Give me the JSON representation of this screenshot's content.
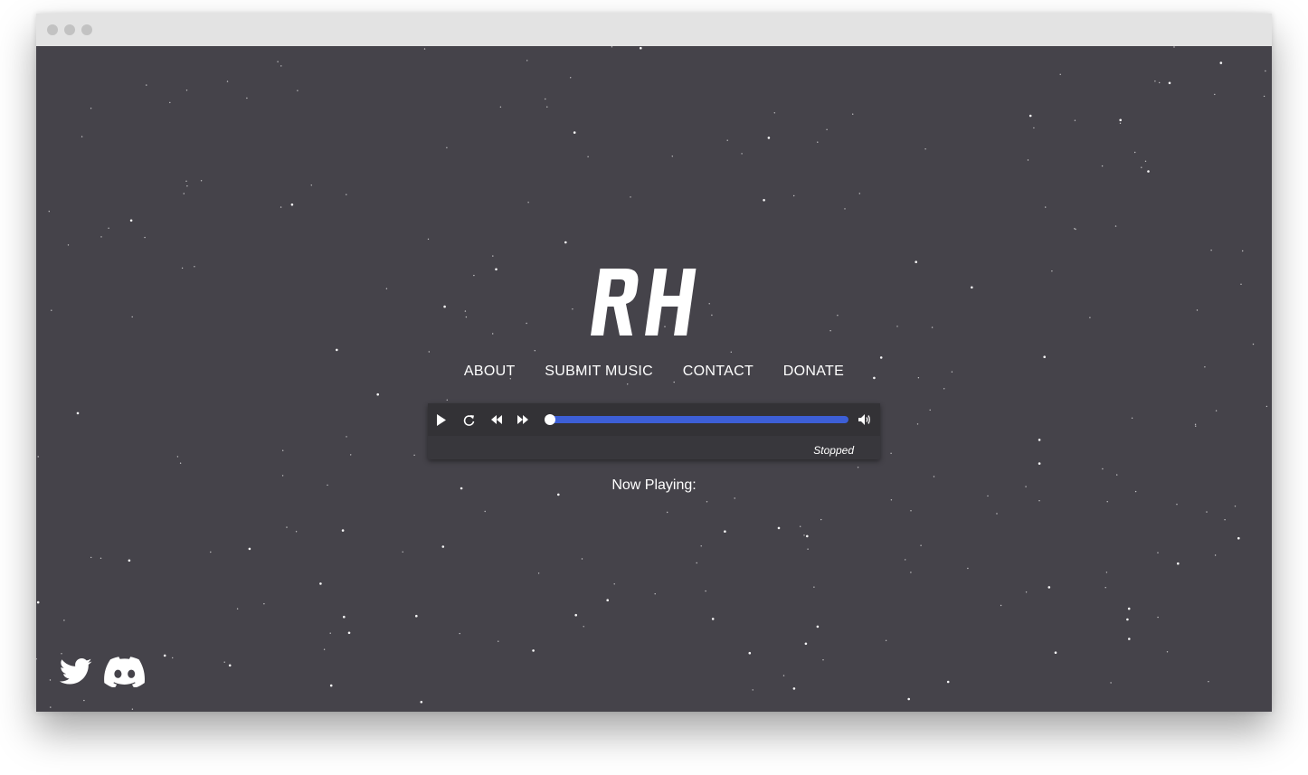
{
  "brand": {
    "logo_text": "RH",
    "icon": "rh-logo"
  },
  "nav": {
    "items": [
      {
        "label": "ABOUT"
      },
      {
        "label": "SUBMIT MUSIC"
      },
      {
        "label": "CONTACT"
      },
      {
        "label": "DONATE"
      }
    ]
  },
  "player": {
    "buttons": [
      {
        "icon": "play-icon"
      },
      {
        "icon": "reload-icon"
      },
      {
        "icon": "rewind-icon"
      },
      {
        "icon": "fast-forward-icon"
      },
      {
        "icon": "volume-icon"
      }
    ],
    "progress_fraction": 1.0,
    "status": "Stopped",
    "accent_color": "#3d5fd6"
  },
  "now_playing": {
    "label": "Now Playing:"
  },
  "social": [
    {
      "icon": "twitter-icon"
    },
    {
      "icon": "discord-icon"
    }
  ],
  "colors": {
    "background": "#45434a",
    "titlebar": "#e3e3e3",
    "player_bg": "#38373c",
    "text": "#ffffff"
  }
}
